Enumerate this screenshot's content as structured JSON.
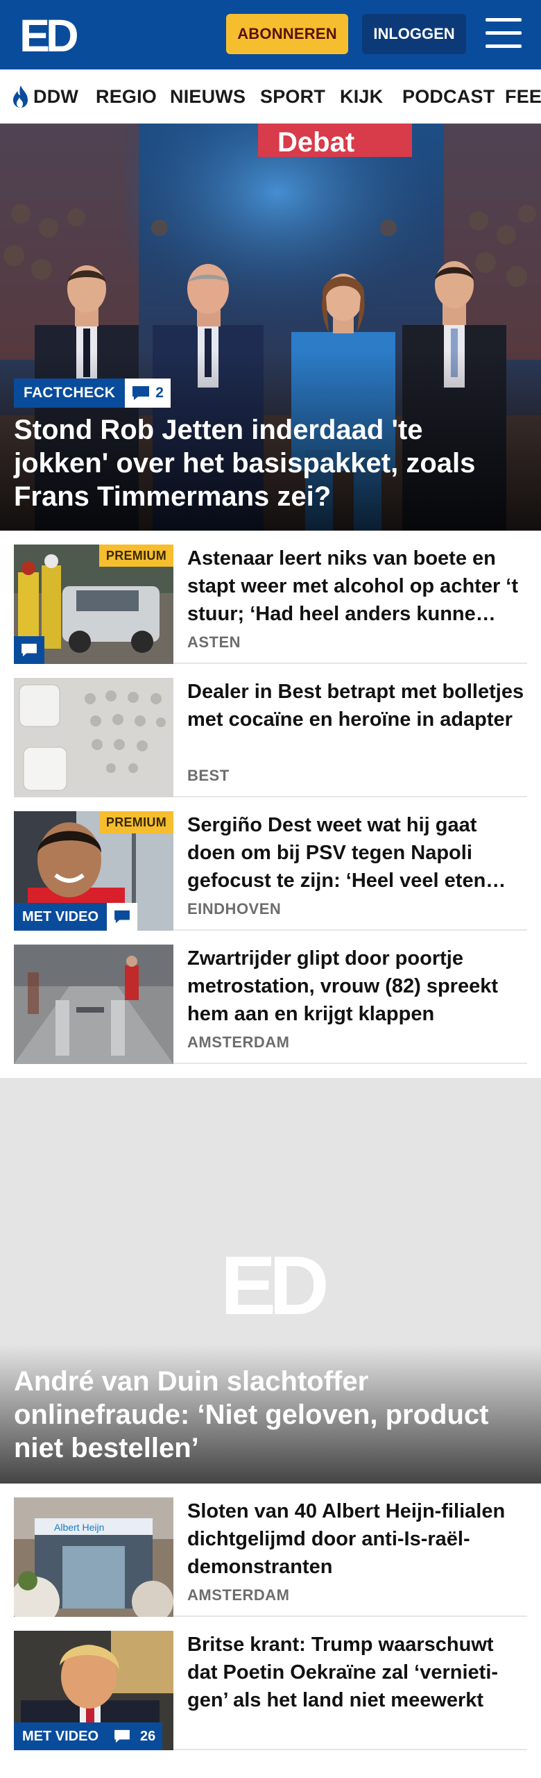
{
  "header": {
    "logo_text": "ED",
    "subscribe_label": "ABONNEREN",
    "login_label": "INLOGGEN",
    "menu_icon": "hamburger-menu-icon",
    "brand_color": "#0a4c9c",
    "accent_color": "#f6be2f"
  },
  "nav": {
    "items": [
      {
        "label": "DDW",
        "icon": "flame-icon"
      },
      {
        "label": "REGIO"
      },
      {
        "label": "NIEUWS"
      },
      {
        "label": "SPORT"
      },
      {
        "label": "KIJK"
      },
      {
        "label": "PODCAST"
      },
      {
        "label": "FEE"
      }
    ]
  },
  "hero": {
    "image_text": "Debat",
    "badge": "FACTCHECK",
    "comment_count": "2",
    "title": "Stond Rob Jetten inderdaad 'te jokken' over het basispakket, zoals Frans Timmermans zei?"
  },
  "articles": [
    {
      "title": "Astenaar leert niks van boete en stapt weer met alcohol op achter ‘t stuur; ‘Had heel anders kunne…",
      "location": "ASTEN",
      "premium": "PREMIUM",
      "has_comment_icon": true
    },
    {
      "title": "Dealer in Best betrapt met bolletjes met cocaïne en heroïne in adapter",
      "location": "BEST"
    },
    {
      "title": "Sergiño Dest weet wat hij gaat doen om bij PSV tegen Napoli gefocust te zijn: ‘Heel veel eten…",
      "location": "EINDHOVEN",
      "premium": "PREMIUM",
      "video_label": "MET VIDEO"
    },
    {
      "title": "Zwartrijder glipt door poortje metrostation, vrouw (82) spreekt hem aan en krijgt klappen",
      "location": "AMSTERDAM"
    }
  ],
  "feature": {
    "logo_text": "ED",
    "title": "André van Duin slachtoffer onlinefraude: ‘Niet geloven, product niet bestellen’"
  },
  "articles2": [
    {
      "title": "Sloten van 40 Albert Heijn-filialen dichtgelijmd door anti-Is-raël-demonstranten",
      "location": "AMSTERDAM",
      "image_text": "Albert Heijn"
    },
    {
      "title": "Britse krant: Trump waarschuwt dat Poetin Oekraïne zal ‘vernieti-gen’ als het land niet meewerkt",
      "video_label": "MET VIDEO",
      "comment_count": "26"
    }
  ]
}
